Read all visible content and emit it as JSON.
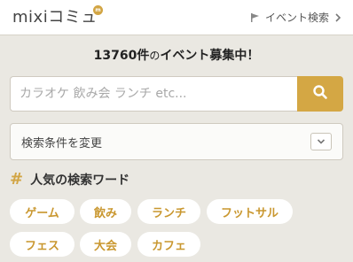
{
  "header": {
    "logo_text": "mixiコミュ",
    "logo_mark": "m",
    "event_search_label": "イベント検索"
  },
  "headline": {
    "count": "13760",
    "unit": "件",
    "of": "の",
    "message": "イベント募集中！"
  },
  "search": {
    "placeholder": "カラオケ 飲み会 ランチ etc..."
  },
  "conditions": {
    "label": "検索条件を変更"
  },
  "popular": {
    "title": "人気の検索ワード",
    "tags": [
      "ゲーム",
      "飲み",
      "ランチ",
      "フットサル",
      "フェス",
      "大会",
      "カフェ"
    ]
  },
  "colors": {
    "accent": "#d4a744",
    "background": "#eae8e2",
    "tag_text": "#c9972f"
  },
  "icons": {
    "flag": "flag-icon",
    "chevron_right": "chevron-right-icon",
    "search": "search-icon",
    "chevron_down": "chevron-down-icon",
    "hash": "hash-icon"
  }
}
